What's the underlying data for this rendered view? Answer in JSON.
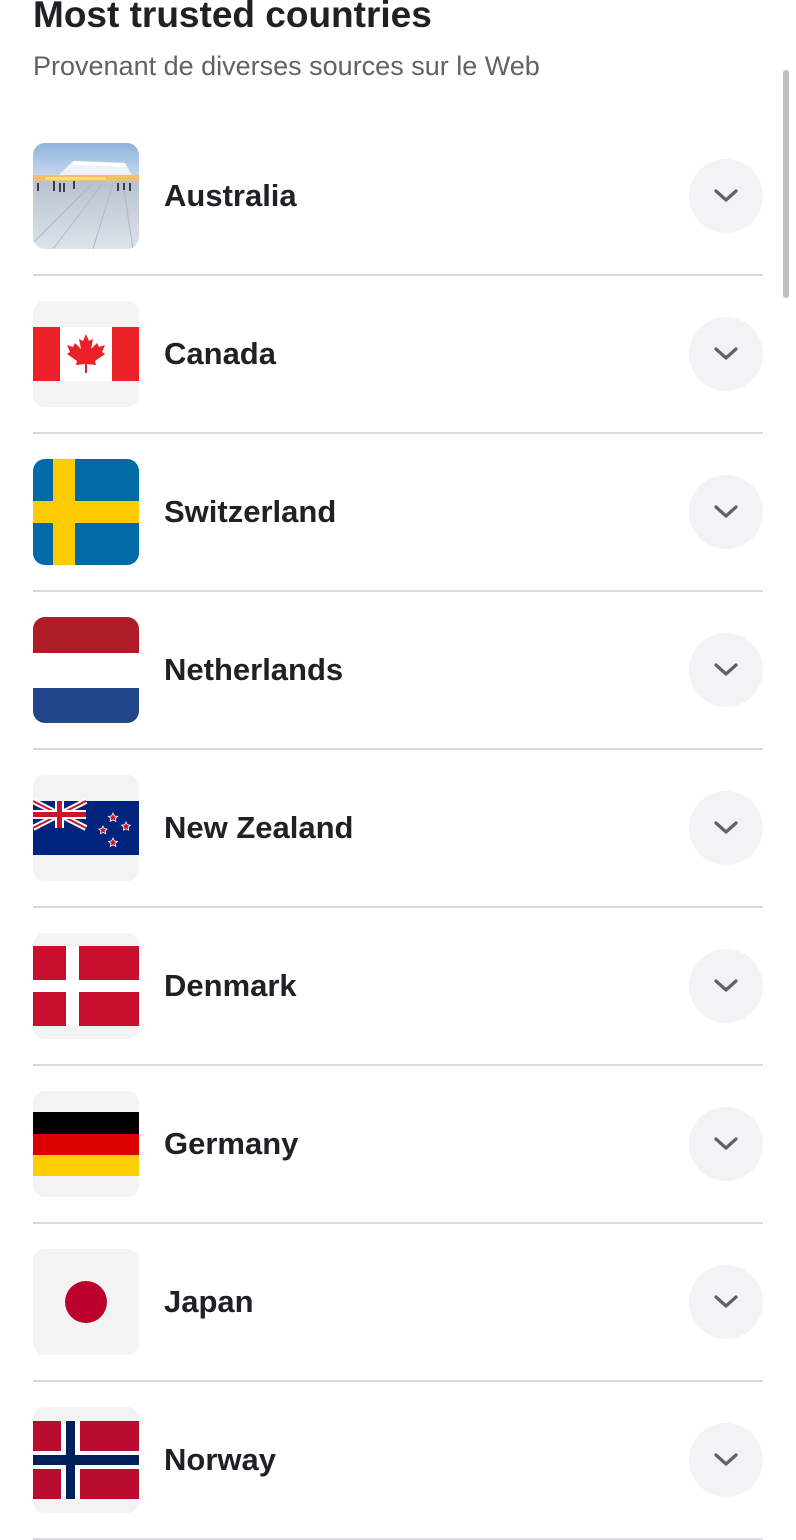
{
  "header": {
    "title": "Most trusted countries",
    "subtitle": "Provenant de diverses sources sur le Web"
  },
  "countries": [
    {
      "name": "Australia",
      "image": "opera-house-photo",
      "expand_icon": "chevron-down-icon"
    },
    {
      "name": "Canada",
      "image": "canada-flag",
      "expand_icon": "chevron-down-icon"
    },
    {
      "name": "Switzerland",
      "image": "sweden-flag",
      "expand_icon": "chevron-down-icon"
    },
    {
      "name": "Netherlands",
      "image": "netherlands-flag",
      "expand_icon": "chevron-down-icon"
    },
    {
      "name": "New Zealand",
      "image": "new-zealand-flag",
      "expand_icon": "chevron-down-icon"
    },
    {
      "name": "Denmark",
      "image": "denmark-flag",
      "expand_icon": "chevron-down-icon"
    },
    {
      "name": "Germany",
      "image": "germany-flag",
      "expand_icon": "chevron-down-icon"
    },
    {
      "name": "Japan",
      "image": "japan-flag",
      "expand_icon": "chevron-down-icon"
    },
    {
      "name": "Norway",
      "image": "norway-flag",
      "expand_icon": "chevron-down-icon"
    }
  ],
  "colors": {
    "title": "#202124",
    "subtitle": "#5f6368",
    "divider": "#dadce0",
    "expand_button": "#f1f3f4"
  }
}
